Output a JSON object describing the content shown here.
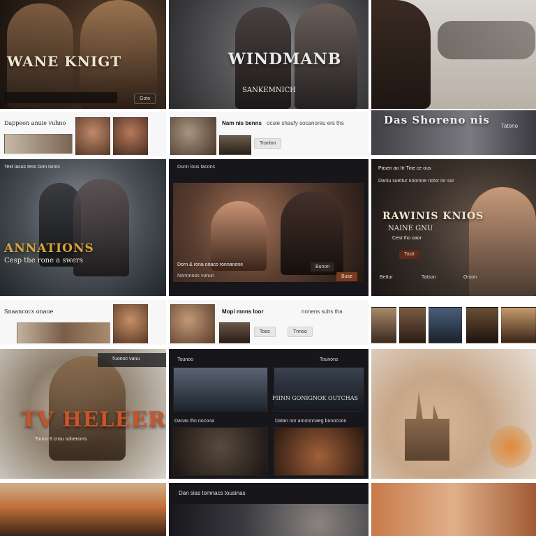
{
  "tiles": {
    "r1c1": {
      "title": "WANE KNIGT",
      "button": "Goto"
    },
    "r1c2": {
      "title": "WINDMANB",
      "subtitle": "SANKEMNICH"
    },
    "strip1": {
      "text": "Dappeon anuie vuhno"
    },
    "strip2": {
      "title": "Nam nis benns",
      "text": "ocuie shaufy socanoreu ers ths",
      "button": "Tranlon"
    },
    "r2c3": {
      "title": "Das Shoreno nis",
      "button": "Tatono"
    },
    "r3c1": {
      "nav": "Text lacus tess Gnn Gnns",
      "title": "ANNATIONS",
      "subtitle": "Cesp the rone a swers"
    },
    "r3c2": {
      "header": "Dunn lous tacons",
      "caption": "Dorn & rona onaco ronnanone",
      "caption2": "Nonnnoos vunun",
      "button1": "Bunon",
      "button2": "Buse"
    },
    "r3c3": {
      "nav": "Pasen ao Itr Tine ce ous",
      "nav2": "Daniu suettur nnorone notor ior sur",
      "title": "RAWINIS KNIOS",
      "subtitle": "NAINE GNU",
      "subtitle2": "Cest tho oaor",
      "button": "Tostt",
      "footer1": "Bettur",
      "footer2": "Tatson",
      "footer3": "Orson"
    },
    "strip3": {
      "text": "Snaancocs onaue"
    },
    "strip4": {
      "title": "Mopi mnns loor",
      "text": "nonens suhs tha",
      "button": "Toos",
      "button2": "Tnnoo"
    },
    "r5c1": {
      "title": "TV HELEERS",
      "subtitle": "Tounn 6 cnsu sdneroms",
      "banner": "Tuonoc vanu"
    },
    "r5c2": {
      "header": "Tounoo",
      "header2": "Tounons",
      "title": "FIINN GONIGNOK OUTCHAS",
      "label1": "Danas thn nocona",
      "label2": "Datan nor amonnnaeg bnnocoon"
    },
    "r6c2": {
      "title": "Dan sias tomnacs tousinas"
    }
  },
  "colors": {
    "accent_gold": "#d9a43a",
    "accent_orange": "#c9532a",
    "dark_bar": "#16161b",
    "button_dark": "#2e2620"
  }
}
